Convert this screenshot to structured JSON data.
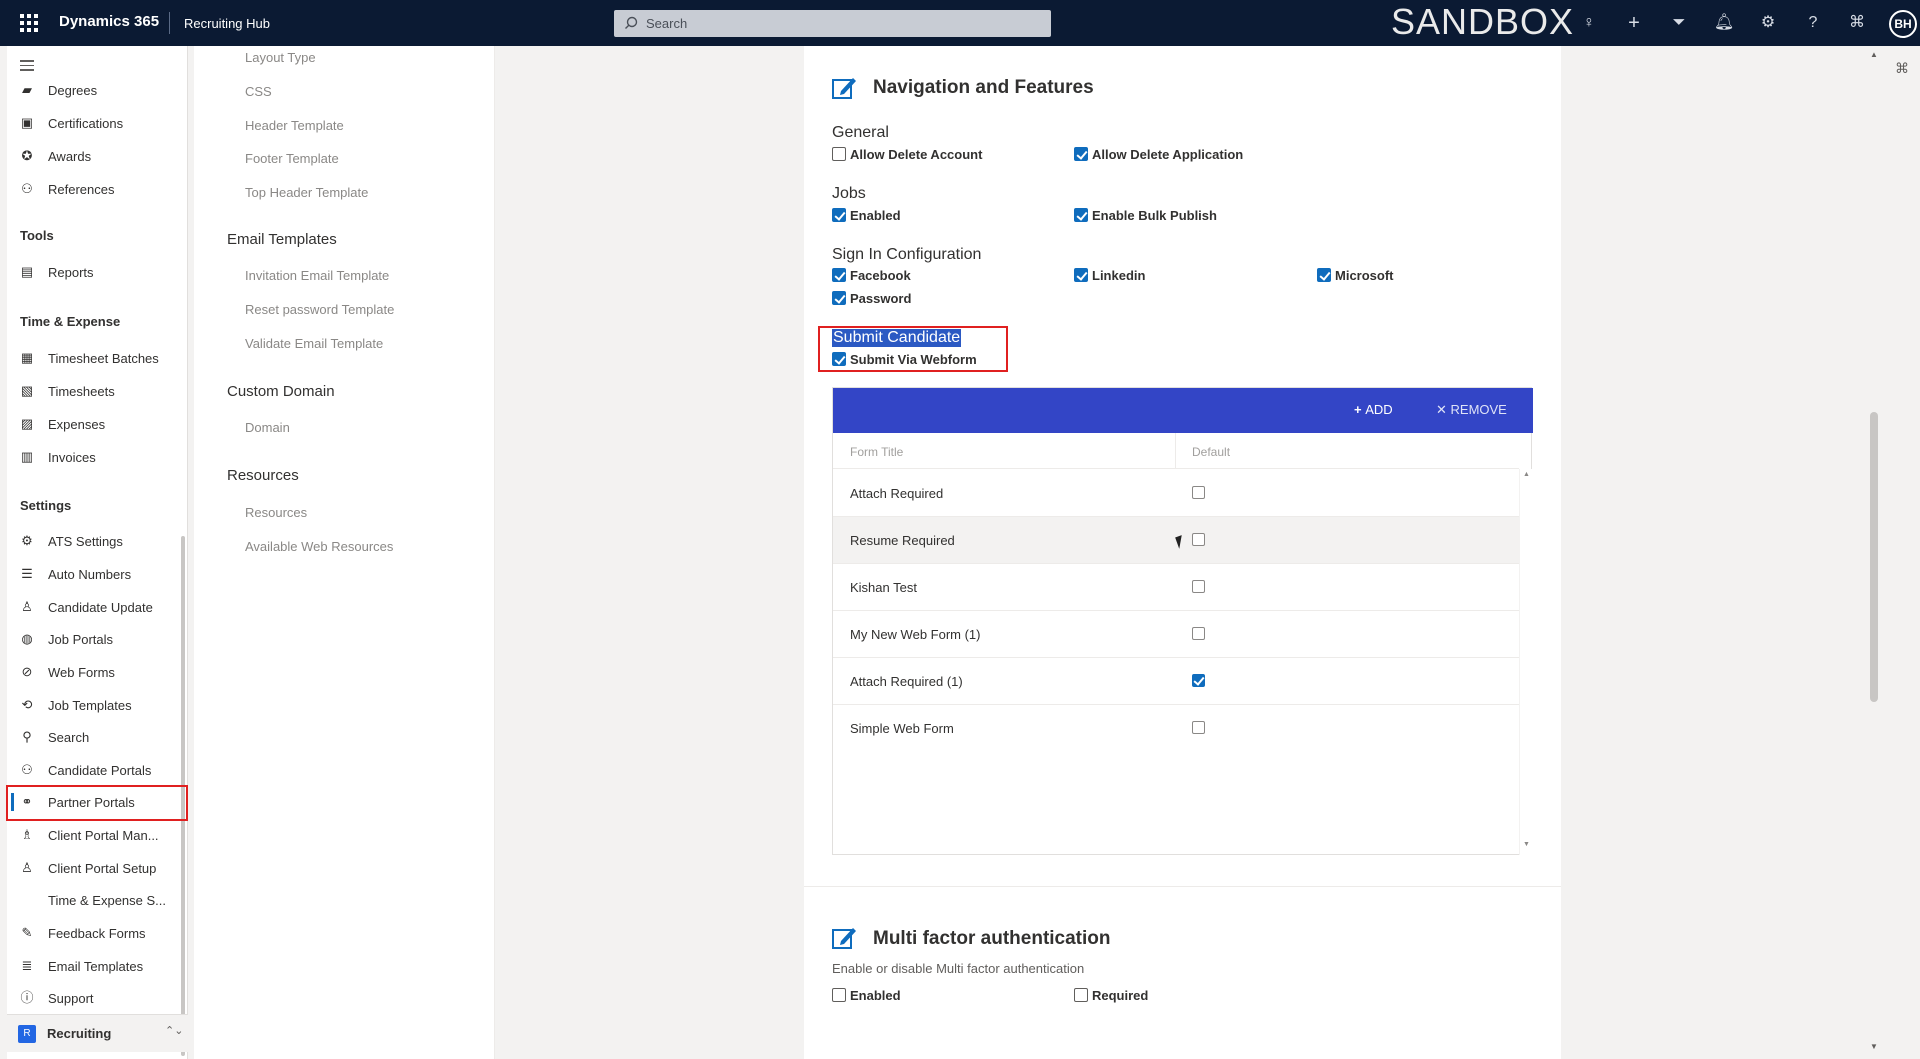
{
  "topbar": {
    "brand": "Dynamics 365",
    "app": "Recruiting Hub",
    "search_placeholder": "Search",
    "env_label": "SANDBOX",
    "user_initials": "BH",
    "icons": [
      "lightbulb-icon",
      "plus-icon",
      "filter-icon",
      "bell-icon",
      "gear-icon",
      "help-icon",
      "copilot-icon"
    ]
  },
  "leftnav": {
    "items_top": [
      {
        "label": "Degrees",
        "icon": "degree-icon"
      },
      {
        "label": "Certifications",
        "icon": "certificate-icon"
      },
      {
        "label": "Awards",
        "icon": "award-icon"
      },
      {
        "label": "References",
        "icon": "references-icon"
      }
    ],
    "tools_title": "Tools",
    "tools": [
      {
        "label": "Reports",
        "icon": "report-icon"
      }
    ],
    "time_title": "Time & Expense",
    "time": [
      {
        "label": "Timesheet Batches",
        "icon": "calendar-icon"
      },
      {
        "label": "Timesheets",
        "icon": "timesheet-icon"
      },
      {
        "label": "Expenses",
        "icon": "expense-icon"
      },
      {
        "label": "Invoices",
        "icon": "invoice-icon"
      }
    ],
    "settings_title": "Settings",
    "settings": [
      {
        "label": "ATS Settings",
        "icon": "gear-icon"
      },
      {
        "label": "Auto Numbers",
        "icon": "list-icon"
      },
      {
        "label": "Candidate Update",
        "icon": "person-icon"
      },
      {
        "label": "Job Portals",
        "icon": "globe-icon"
      },
      {
        "label": "Web Forms",
        "icon": "form-icon"
      },
      {
        "label": "Job Templates",
        "icon": "template-icon"
      },
      {
        "label": "Search",
        "icon": "search-icon"
      },
      {
        "label": "Candidate Portals",
        "icon": "portal-icon"
      },
      {
        "label": "Partner Portals",
        "icon": "partner-icon"
      },
      {
        "label": "Client Portal Man...",
        "icon": "client-icon"
      },
      {
        "label": "Client Portal Setup",
        "icon": "person-icon"
      },
      {
        "label": "Time & Expense S...",
        "icon": ""
      },
      {
        "label": "Feedback Forms",
        "icon": "feedback-icon"
      },
      {
        "label": "Email Templates",
        "icon": "stack-icon"
      },
      {
        "label": "Support",
        "icon": "help-icon"
      }
    ],
    "area": {
      "badge": "R",
      "label": "Recruiting"
    }
  },
  "midpanel": {
    "links_top": [
      "Layout Type",
      "CSS",
      "Header Template",
      "Footer Template",
      "Top Header Template"
    ],
    "email_title": "Email Templates",
    "email_links": [
      "Invitation Email Template",
      "Reset password Template",
      "Validate Email Template"
    ],
    "domain_title": "Custom Domain",
    "domain_links": [
      "Domain"
    ],
    "resources_title": "Resources",
    "resources_links": [
      "Resources",
      "Available Web Resources"
    ]
  },
  "nav_features": {
    "title": "Navigation and Features",
    "general": {
      "title": "General",
      "allow_delete_account": "Allow Delete Account",
      "allow_delete_application": "Allow Delete Application"
    },
    "jobs": {
      "title": "Jobs",
      "enabled": "Enabled",
      "bulk_publish": "Enable Bulk Publish"
    },
    "signin": {
      "title": "Sign In Configuration",
      "facebook": "Facebook",
      "linkedin": "Linkedin",
      "microsoft": "Microsoft",
      "password": "Password"
    },
    "submit": {
      "title": "Submit Candidate",
      "via_webform": "Submit Via Webform"
    }
  },
  "forms_table": {
    "add_label": "ADD",
    "remove_label": "REMOVE",
    "col_title": "Form Title",
    "col_default": "Default",
    "rows": [
      {
        "title": "Attach Required",
        "default": false
      },
      {
        "title": "Resume Required",
        "default": false
      },
      {
        "title": "Kishan Test",
        "default": false
      },
      {
        "title": "My New Web Form (1)",
        "default": false
      },
      {
        "title": "Attach Required (1)",
        "default": true
      },
      {
        "title": "Simple Web Form",
        "default": false
      }
    ]
  },
  "mfa": {
    "title": "Multi factor authentication",
    "description": "Enable or disable Multi factor authentication",
    "enabled": "Enabled",
    "required": "Required"
  },
  "colors": {
    "topbar": "#0b1a33",
    "accent": "#0f6cbd",
    "table_header": "#3345c6",
    "highlight": "#e02020"
  }
}
